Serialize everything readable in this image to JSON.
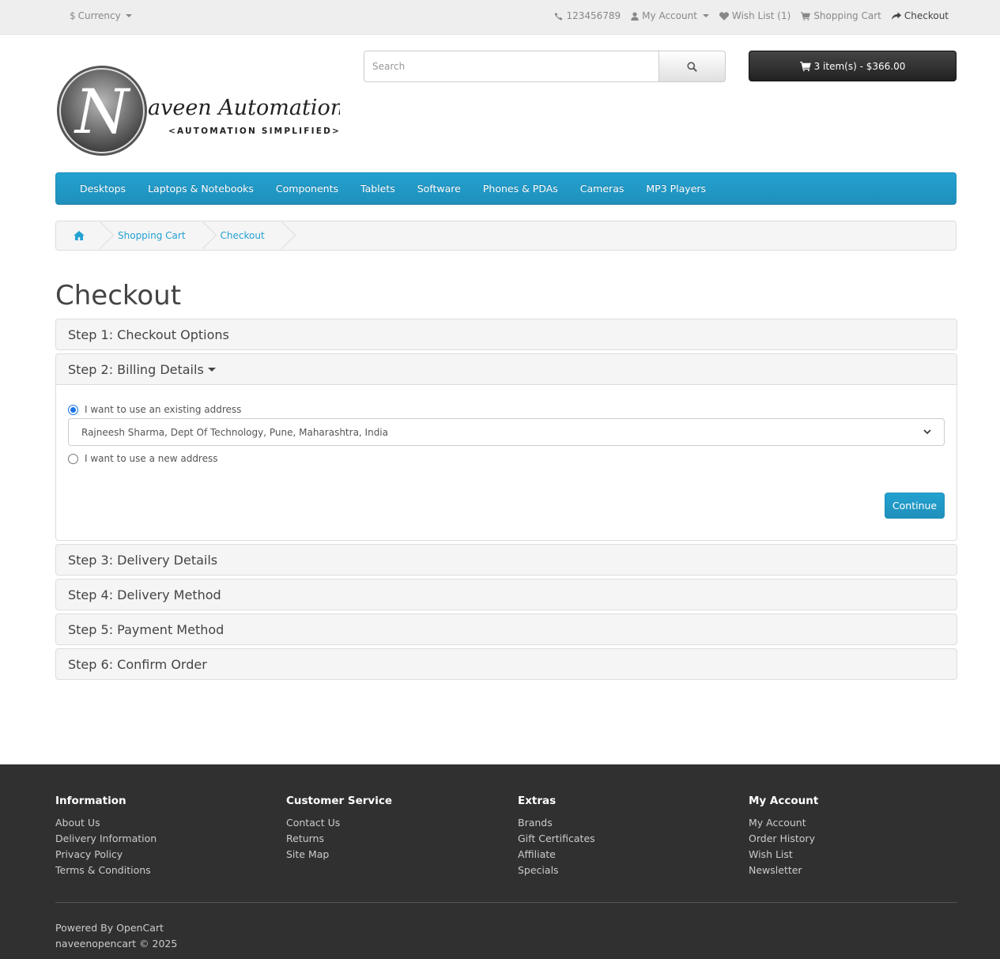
{
  "topbar": {
    "currency_symbol": "$",
    "currency_label": "Currency",
    "phone": "123456789",
    "my_account": "My Account",
    "wishlist": "Wish List (1)",
    "shopping_cart": "Shopping Cart",
    "checkout": "Checkout"
  },
  "logo": {
    "brand_initial": "N",
    "brand_text": "aveen Automation Labs",
    "tagline": "<AUTOMATION SIMPLIFIED>"
  },
  "search": {
    "placeholder": "Search"
  },
  "cart": {
    "label": "3 item(s) - $366.00"
  },
  "menu": [
    "Desktops",
    "Laptops & Notebooks",
    "Components",
    "Tablets",
    "Software",
    "Phones & PDAs",
    "Cameras",
    "MP3 Players"
  ],
  "breadcrumb": [
    "Shopping Cart",
    "Checkout"
  ],
  "page_title": "Checkout",
  "steps": {
    "s1": "Step 1: Checkout Options",
    "s2": "Step 2: Billing Details",
    "s3": "Step 3: Delivery Details",
    "s4": "Step 4: Delivery Method",
    "s5": "Step 5: Payment Method",
    "s6": "Step 6: Confirm Order"
  },
  "billing": {
    "existing_label": "I want to use an existing address",
    "selected_address": "Rajneesh Sharma, Dept Of Technology, Pune, Maharashtra, India",
    "new_label": "I want to use a new address",
    "continue": "Continue"
  },
  "footer": {
    "information": {
      "title": "Information",
      "links": [
        "About Us",
        "Delivery Information",
        "Privacy Policy",
        "Terms & Conditions"
      ]
    },
    "customer_service": {
      "title": "Customer Service",
      "links": [
        "Contact Us",
        "Returns",
        "Site Map"
      ]
    },
    "extras": {
      "title": "Extras",
      "links": [
        "Brands",
        "Gift Certificates",
        "Affiliate",
        "Specials"
      ]
    },
    "my_account": {
      "title": "My Account",
      "links": [
        "My Account",
        "Order History",
        "Wish List",
        "Newsletter"
      ]
    },
    "powered_prefix": "Powered By",
    "powered_link": "OpenCart",
    "copyright": "naveenopencart © 2025"
  },
  "colors": {
    "accent": "#23a1d1",
    "footer_bg": "#303030",
    "cart_bg": "#363636"
  }
}
